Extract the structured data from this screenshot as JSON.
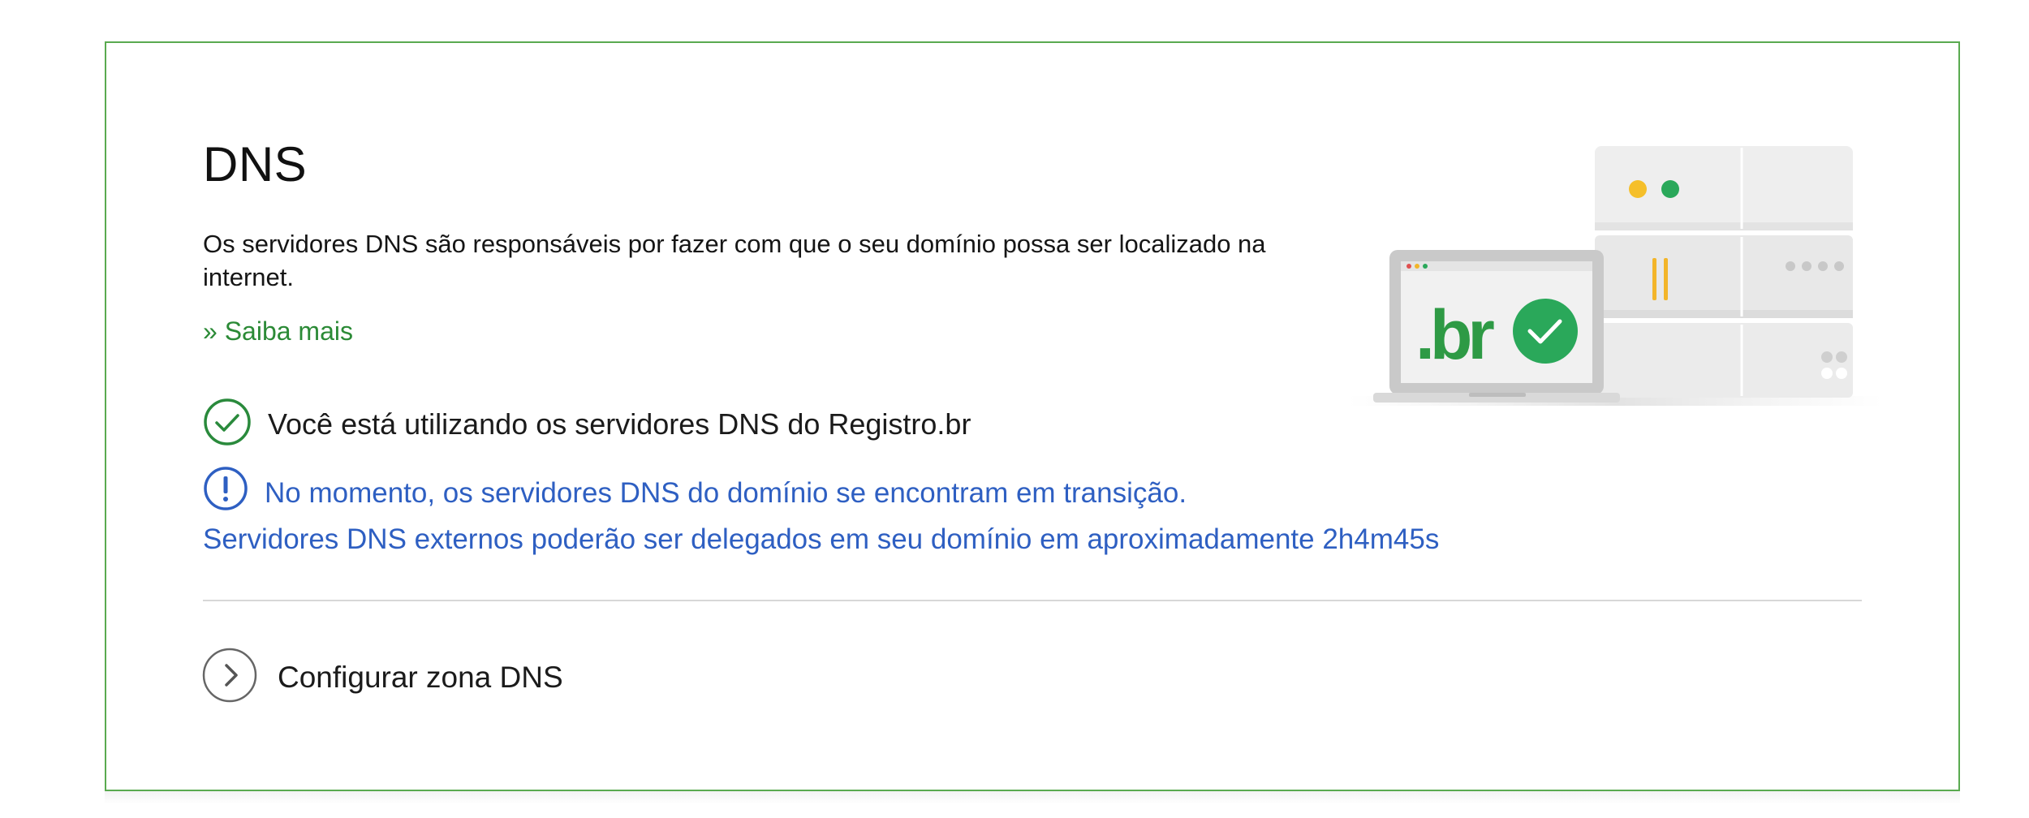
{
  "dns_section": {
    "title": "DNS",
    "description": "Os servidores DNS são responsáveis por fazer com que o seu domínio possa ser localizado na internet.",
    "learn_more": "» Saiba mais",
    "status_message": "Você está utilizando os servidores DNS do Registro.br",
    "notice_line1": "No momento, os servidores DNS do domínio se encontram em transição.",
    "notice_line2": "Servidores DNS externos poderão ser delegados em seu domínio em aproximadamente 2h4m45s",
    "configure_label": "Configurar zona DNS",
    "illustration_logo": ".br"
  },
  "colors": {
    "border": "#5aaa50",
    "link": "#2b8a36",
    "notice": "#2e5fc2",
    "success": "#2a8a3c"
  },
  "icons": {
    "status": "check-circle-icon",
    "notice": "exclamation-circle-icon",
    "configure": "chevron-right-circle-icon"
  }
}
